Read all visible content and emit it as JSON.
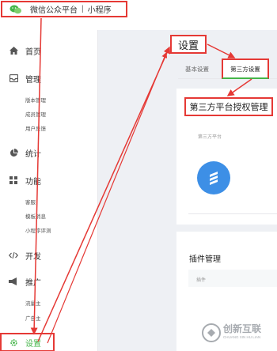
{
  "header": {
    "app_name": "微信公众平台",
    "separator": "|",
    "section": "小程序"
  },
  "sidebar": {
    "home": "首页",
    "manage": {
      "label": "管理",
      "items": [
        "版本管理",
        "成员管理",
        "用户反馈"
      ]
    },
    "stats": "统计",
    "features": {
      "label": "功能",
      "items": [
        "客服",
        "模板消息",
        "小程序评测"
      ]
    },
    "dev": "开发",
    "promote": {
      "label": "推广",
      "items": [
        "流量主",
        "广告主"
      ]
    },
    "settings": "设置"
  },
  "main": {
    "page_title": "设置",
    "tabs": [
      "基本设置",
      "第三方设置"
    ],
    "active_tab": "第三方设置",
    "third_party_card": {
      "title": "第三方平台授权管理",
      "label": "第三方平台"
    },
    "plugin_card": {
      "title": "插件管理",
      "column": "插件"
    }
  },
  "watermark": {
    "text": "创新互联",
    "sub": "CHUANG XIN HU LIAN"
  },
  "colors": {
    "accent_green": "#44b549",
    "annotation_red": "#e53935",
    "logo_blue": "#3d8fe6"
  }
}
